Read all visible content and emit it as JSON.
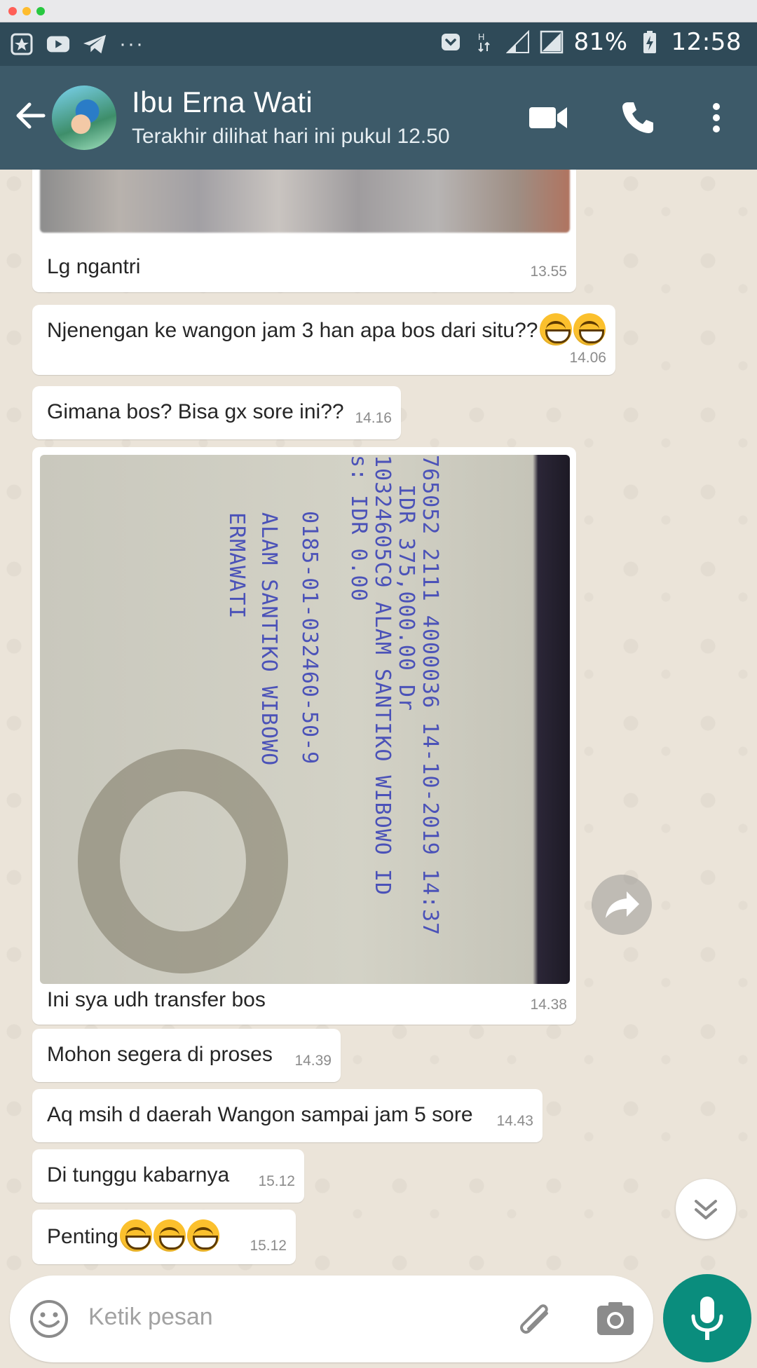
{
  "status_bar": {
    "battery": "81%",
    "time": "12:58",
    "more": "···"
  },
  "header": {
    "contact_name": "Ibu Erna Wati",
    "last_seen": "Terakhir dilihat hari ini pukul 12.50"
  },
  "messages": [
    {
      "text": "Lg ngantri",
      "time": "13.55",
      "has_image": true
    },
    {
      "text": "Njenengan ke wangon jam 3 han apa bos dari situ??",
      "emoji_count": 2,
      "time": "14.06"
    },
    {
      "text": "Gimana bos? Bisa gx sore ini??",
      "time": "14.16"
    },
    {
      "text": "Ini sya udh transfer bos",
      "time": "14.38",
      "has_image": true
    },
    {
      "text": "Mohon segera di proses",
      "time": "14.39"
    },
    {
      "text": "Aq msih d daerah Wangon sampai jam 5 sore",
      "time": "14.43"
    },
    {
      "text": "Di tunggu kabarnya",
      "time": "15.12"
    },
    {
      "text": "Penting",
      "emoji_count": 3,
      "time": "15.12"
    }
  ],
  "receipt_image": {
    "lines": [
      "765052 2111 4000036 14-10-2019 14:37",
      "IDR 375,000.00 Dr",
      "10324605C9 ALAM SANTIKO WIBOWO ID",
      "s: IDR 0.00",
      "0185-01-032460-50-9",
      "ALAM SANTIKO WIBOWO",
      "ERMAWATI"
    ]
  },
  "input": {
    "placeholder": "Ketik pesan"
  },
  "colors": {
    "header": "#3d5a69",
    "status_bar": "#2f4a58",
    "mic": "#0a8d7d",
    "chat_bg": "#ebe4d9"
  }
}
